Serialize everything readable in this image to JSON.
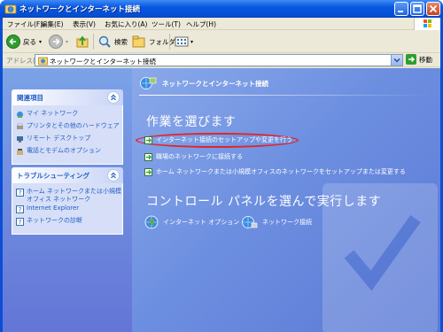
{
  "window": {
    "title": "ネットワークとインターネット接続",
    "controls": [
      "minimize",
      "maximize",
      "close"
    ]
  },
  "menubar": {
    "items": [
      "ファイル(F)",
      "編集(E)",
      "表示(V)",
      "お気に入り(A)",
      "ツール(T)",
      "ヘルプ(H)"
    ]
  },
  "toolbar": {
    "back_label": "戻る",
    "search_label": "検索",
    "folders_label": "フォルダ"
  },
  "addressbar": {
    "label": "アドレス(D)",
    "value": "ネットワークとインターネット接続",
    "go_label": "移動"
  },
  "sidebar": {
    "related": {
      "title": "関連項目",
      "items": [
        {
          "label": "マイ ネットワーク",
          "icon": "network-places-icon"
        },
        {
          "label": "プリンタとその他のハードウェア",
          "icon": "printer-icon"
        },
        {
          "label": "リモート デスクトップ",
          "icon": "remote-desktop-icon"
        },
        {
          "label": "電話とモデムのオプション",
          "icon": "phone-modem-icon"
        }
      ]
    },
    "troubleshoot": {
      "title": "トラブルシューティング",
      "items": [
        {
          "label": "ホーム ネットワークまたは小規模オフィス ネットワーク",
          "icon": "help-icon"
        },
        {
          "label": "Internet Explorer",
          "icon": "help-icon"
        },
        {
          "label": "ネットワークの診断",
          "icon": "help-icon"
        }
      ]
    }
  },
  "main": {
    "header": "ネットワークとインターネット接続",
    "pick_task_title": "作業を選びます",
    "tasks": [
      {
        "label": "インターネット接続のセットアップや変更を行う",
        "highlighted": true
      },
      {
        "label": "職場のネットワークに接続する",
        "highlighted": false
      },
      {
        "label": "ホーム ネットワークまたは小規模オフィスのネットワークをセットアップまたは変更する",
        "highlighted": false
      }
    ],
    "pick_cp_title": "コントロール パネルを選んで実行します",
    "control_panels": [
      {
        "label": "インターネット オプション",
        "icon": "globe-icon"
      },
      {
        "label": "ネットワーク接続",
        "icon": "network-connections-icon"
      }
    ]
  },
  "colors": {
    "title_bar": "#0a58e0",
    "highlight": "#e0262a",
    "task_link": "#215dc6"
  }
}
